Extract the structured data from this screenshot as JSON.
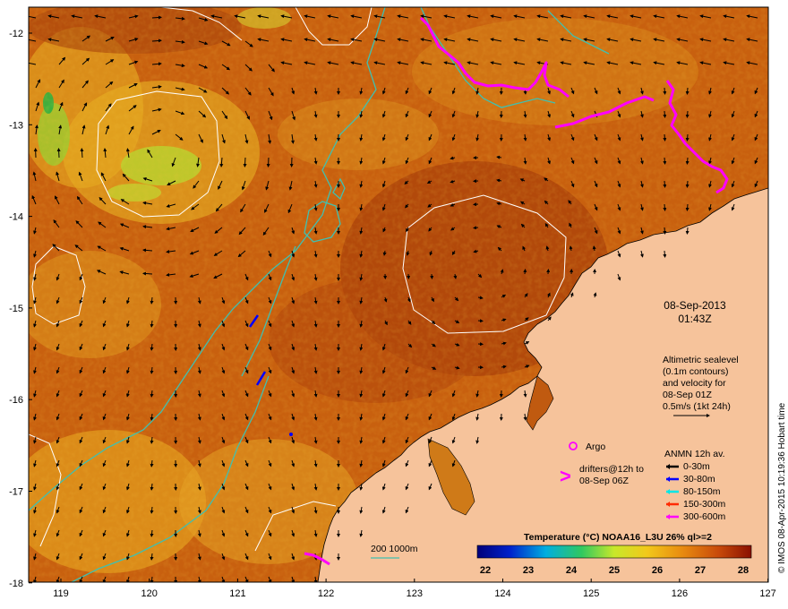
{
  "map": {
    "date": "08-Sep-2013",
    "time": "01:43Z",
    "sealevel_note": [
      "Altimetric sealevel",
      "(0.1m contours)",
      "and velocity for",
      "08-Sep 01Z",
      "0.5m/s (1kt 24h)"
    ],
    "argo_label": "Argo",
    "drifters_label": [
      "drifters@12h to",
      "08-Sep 06Z"
    ],
    "anmn_title": "ANMN 12h av.",
    "anmn_depths": [
      {
        "label": "0-30m",
        "color": "#000000"
      },
      {
        "label": "30-80m",
        "color": "#0000ff"
      },
      {
        "label": "80-150m",
        "color": "#00e5e5"
      },
      {
        "label": "150-300m",
        "color": "#ff2a00"
      },
      {
        "label": "300-600m",
        "color": "#ff00ff"
      }
    ],
    "isobath_label": "200  1000m",
    "colorbar_title": "Temperature (°C) NOAA16_L3U 26% ql>=2",
    "colorbar_ticks": [
      "22",
      "23",
      "24",
      "25",
      "26",
      "27",
      "28"
    ],
    "credit": "© IMOS 08-Apr-2015 10:19:36 Hobart time",
    "lat_ticks": [
      "-12",
      "-13",
      "-14",
      "-15",
      "-16",
      "-17",
      "-18"
    ],
    "lon_ticks": [
      "119",
      "120",
      "121",
      "122",
      "123",
      "124",
      "125",
      "126",
      "127"
    ],
    "colors": {
      "land": "#f6c39b",
      "sea_base": "#c45a10",
      "contour": "#ffffff",
      "isobath": "#40c0b0",
      "drifter": "#ff00ff",
      "argo": "#ff00ff"
    }
  }
}
